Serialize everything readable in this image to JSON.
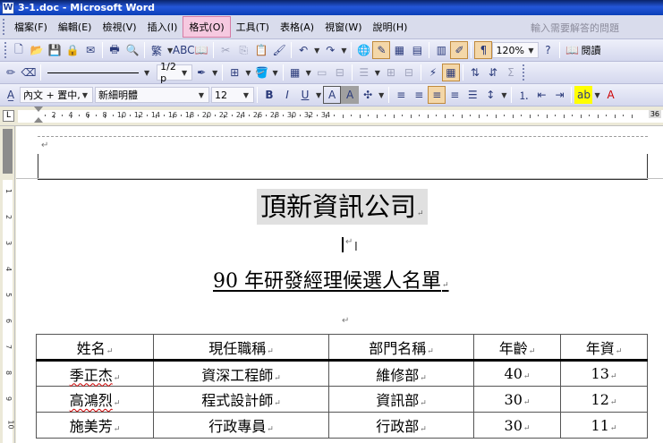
{
  "titlebar": {
    "title": "3-1.doc - Microsoft Word",
    "icon": "W"
  },
  "menubar": {
    "items": [
      {
        "label": "檔案(F)"
      },
      {
        "label": "編輯(E)"
      },
      {
        "label": "檢視(V)"
      },
      {
        "label": "插入(I)"
      },
      {
        "label": "格式(O)"
      },
      {
        "label": "工具(T)"
      },
      {
        "label": "表格(A)"
      },
      {
        "label": "視窗(W)"
      },
      {
        "label": "說明(H)"
      }
    ],
    "help_placeholder": "輸入需要解答的問題"
  },
  "toolbar1": {
    "convert_label": "繁",
    "zoom": "120%",
    "read_label": "閱讀"
  },
  "toolbar2": {
    "line_weight": "1/2 p"
  },
  "toolbar3": {
    "style": "內文 + 置中, ",
    "font": "新細明體",
    "size": "12",
    "bold": "B",
    "italic": "I",
    "underline": "U",
    "char_border": "A",
    "char_shade": "A"
  },
  "ruler": {
    "tab_marker": "L",
    "ticks": [
      "2",
      "4",
      "6",
      "8",
      "10",
      "12",
      "14",
      "16",
      "18",
      "20",
      "22",
      "24",
      "26",
      "28",
      "30",
      "32",
      "34"
    ],
    "right_value": "36",
    "vticks": [
      "1",
      "2",
      "3",
      "4",
      "5",
      "6",
      "7",
      "8",
      "9",
      "10"
    ]
  },
  "document": {
    "company": "頂新資訊公司",
    "subtitle": "90 年研發經理候選人名單",
    "para_mark": "↵",
    "table": {
      "headers": [
        "姓名",
        "現任職稱",
        "部門名稱",
        "年齡",
        "年資"
      ],
      "rows": [
        [
          "季正杰",
          "資深工程師",
          "維修部",
          "40",
          "13"
        ],
        [
          "高鴻烈",
          "程式設計師",
          "資訊部",
          "30",
          "12"
        ],
        [
          "施美芳",
          "行政專員",
          "行政部",
          "30",
          "11"
        ]
      ]
    }
  }
}
